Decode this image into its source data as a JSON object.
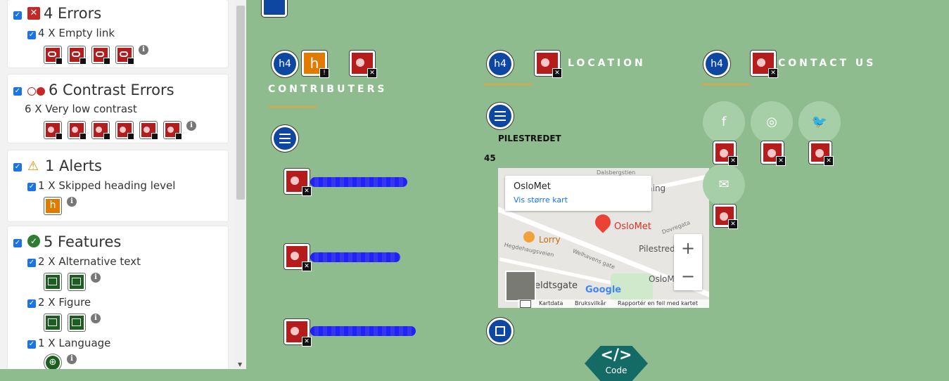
{
  "panel": {
    "errors": {
      "title": "4 Errors",
      "items": [
        {
          "label": "4 X Empty link",
          "count": 4
        }
      ]
    },
    "contrast": {
      "title": "6 Contrast Errors",
      "items": [
        {
          "label": "6 X Very low contrast",
          "count": 6
        }
      ]
    },
    "alerts": {
      "title": "1 Alerts",
      "items": [
        {
          "label": "1 X Skipped heading level",
          "count": 1
        }
      ]
    },
    "features": {
      "title": "5 Features",
      "items": [
        {
          "label": "2 X Alternative text",
          "count": 2
        },
        {
          "label": "2 X Figure",
          "count": 2
        },
        {
          "label": "1 X Language",
          "count": 1
        }
      ]
    },
    "info_glyph": "i",
    "check_glyph": "✓"
  },
  "site": {
    "heading_h4": "h4",
    "alert_glyph": "h",
    "contributers": {
      "heading": "CONTRIBUTERS"
    },
    "location": {
      "heading": "LOCATION",
      "street": "PILESTREDET",
      "number": "45"
    },
    "contact": {
      "heading": "CONTACT US"
    },
    "social": [
      {
        "icon": "facebook-icon",
        "glyph": "f"
      },
      {
        "icon": "instagram-icon",
        "glyph": "◎"
      },
      {
        "icon": "twitter-icon",
        "glyph": "🐦"
      },
      {
        "icon": "mail-icon",
        "glyph": "✉"
      }
    ],
    "map": {
      "popup_title": "OsloMet",
      "popup_link": "Vis større kart",
      "marker_label": "OsloMet",
      "places": [
        "Lorry",
        "Pilestredet",
        "OsloMet",
        "Google",
        "Bruksvilkår"
      ],
      "street_labels": [
        "Pilestredet",
        "Welhavens gate",
        "Dovregata",
        "Hegdehaugsveien",
        "eldtsgate",
        "ning",
        "Dalsbergstien"
      ],
      "zoom_in": "+",
      "zoom_out": "−",
      "footer": [
        "Kartdata",
        "Bruksvilkår",
        "Rapportér en feil med kartet"
      ]
    },
    "code_badge": "</>",
    "code_label": "Code"
  },
  "colors": {
    "page_bg": "#8fbc8f",
    "error_red": "#b71c1c",
    "alert_orange": "#e07b00",
    "feature_green": "#1b5e20",
    "heading_blue": "#0d47a1",
    "underline": "#e8a33d"
  }
}
